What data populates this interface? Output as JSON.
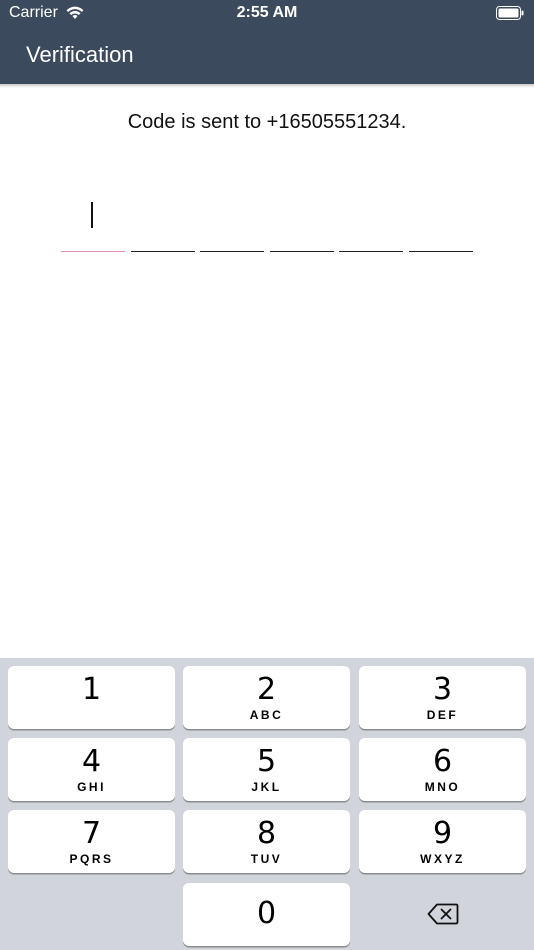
{
  "status_bar": {
    "carrier": "Carrier",
    "time": "2:55 AM",
    "wifi_icon": "wifi-icon",
    "battery_icon": "battery-icon"
  },
  "nav": {
    "title": "Verification"
  },
  "verification": {
    "message": "Code is sent to +16505551234.",
    "code_digits": [
      "",
      "",
      "",
      "",
      "",
      ""
    ],
    "active_index": 0,
    "active_color": "#e48bb8"
  },
  "keypad": {
    "keys": [
      {
        "digit": "1",
        "letters": ""
      },
      {
        "digit": "2",
        "letters": "ABC"
      },
      {
        "digit": "3",
        "letters": "DEF"
      },
      {
        "digit": "4",
        "letters": "GHI"
      },
      {
        "digit": "5",
        "letters": "JKL"
      },
      {
        "digit": "6",
        "letters": "MNO"
      },
      {
        "digit": "7",
        "letters": "PQRS"
      },
      {
        "digit": "8",
        "letters": "TUV"
      },
      {
        "digit": "9",
        "letters": "WXYZ"
      },
      {
        "digit": "0",
        "letters": ""
      }
    ],
    "delete_icon": "backspace-icon"
  },
  "colors": {
    "header_bg": "#3b4a5c",
    "keyboard_bg": "#d1d4da"
  }
}
